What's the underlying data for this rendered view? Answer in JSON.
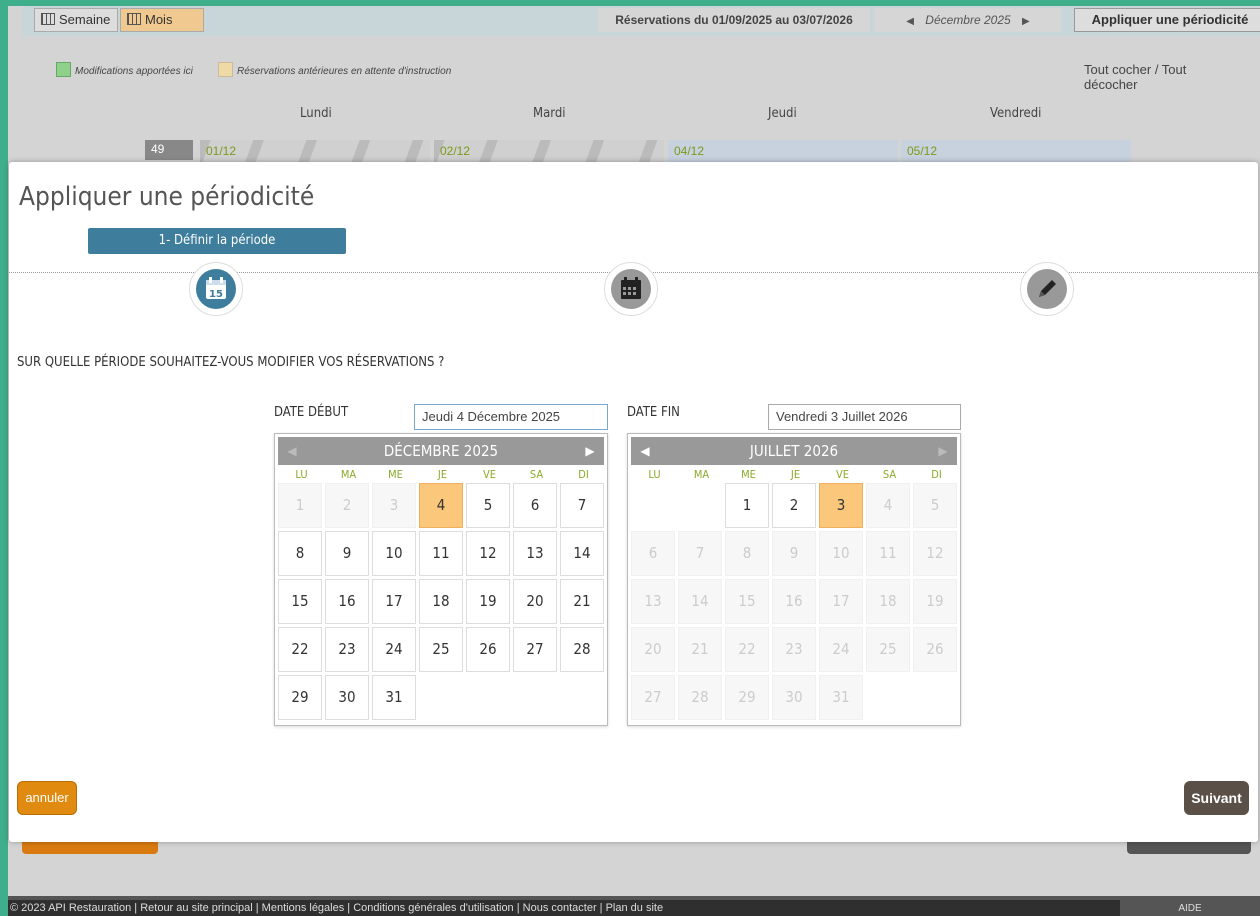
{
  "topbar": {
    "week_label": "Semaine",
    "month_label": "Mois",
    "period": "Réservations du 01/09/2025 au 03/07/2026",
    "current_month": "Décembre 2025",
    "prev_arrow": "◀",
    "next_arrow": "▶",
    "apply_label": "Appliquer une périodicité"
  },
  "legend": {
    "changes": "Modifications apportées ici",
    "pending": "Réservations antérieures en attente d'instruction",
    "changes_color": "#8fd18b",
    "pending_color": "#efd9a6"
  },
  "check_all": "Tout cocher  /  Tout décocher",
  "day_headers": [
    "Lundi",
    "Mardi",
    "Jeudi",
    "Vendredi"
  ],
  "week": {
    "number": "49",
    "dates": [
      "01/12",
      "02/12",
      "04/12",
      "05/12"
    ]
  },
  "modal": {
    "title": "Appliquer une périodicité",
    "step_label": "1- Définir la période",
    "question": "SUR QUELLE PÉRIODE SOUHAITEZ-VOUS MODIFIER VOS RÉSERVATIONS ?",
    "start_label": "DATE DÉBUT",
    "start_value": "Jeudi 4 Décembre 2025",
    "end_label": "DATE FIN",
    "end_value": "Vendredi 3 Juillet 2026",
    "weekdays": [
      "LU",
      "MA",
      "ME",
      "JE",
      "VE",
      "SA",
      "DI"
    ],
    "cal_start": {
      "title": "DÉCEMBRE 2025",
      "selected": 4,
      "disabled_before": 4,
      "first_weekday_index": 0,
      "days_in_month": 31
    },
    "cal_end": {
      "title": "JUILLET 2026",
      "selected": 3,
      "disabled_after": 3,
      "first_weekday_index": 2,
      "days_in_month": 31
    },
    "cancel_label": "annuler",
    "next_label": "Suivant",
    "accent_color": "#3e7d9c",
    "selected_color": "#fbc77a"
  },
  "footer": {
    "text": "© 2023 API Restauration | Retour au site principal | Mentions légales | Conditions générales d'utilisation | Nous contacter | Plan du site",
    "help": "AIDE"
  }
}
